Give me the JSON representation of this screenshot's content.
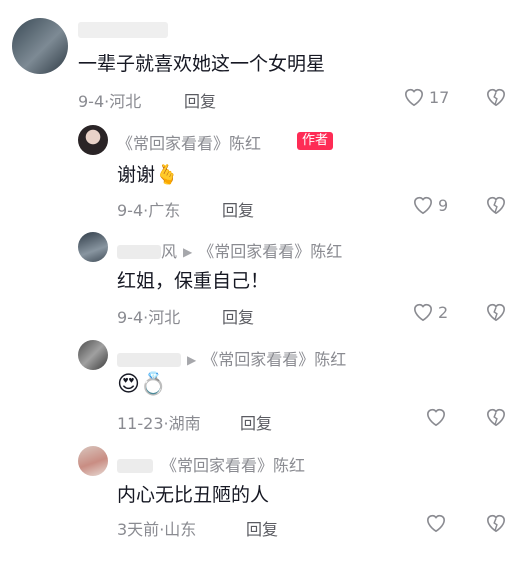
{
  "comments": [
    {
      "text": "一辈子就喜欢她这一个女明星",
      "date": "9-4",
      "location": "河北",
      "reply": "回复",
      "likes": "17"
    },
    {
      "name": "《常回家看看》陈红",
      "author_badge": "作者",
      "text": "谢谢",
      "emoji": "🫰",
      "date": "9-4",
      "location": "广东",
      "reply": "回复",
      "likes": "9"
    },
    {
      "name_visible": "风",
      "reply_to": "《常回家看看》陈红",
      "text": "红姐，保重自己！",
      "date": "9-4",
      "location": "河北",
      "reply": "回复",
      "likes": "2"
    },
    {
      "reply_to": "《常回家看看》陈红",
      "emoji": "😍💍",
      "date": "11-23",
      "location": "湖南",
      "reply": "回复",
      "likes": ""
    },
    {
      "reply_to": "《常回家看看》陈红",
      "text": "内心无比丑陋的人",
      "date": "3天前",
      "location": "山东",
      "reply": "回复",
      "likes": ""
    }
  ],
  "separator": "·"
}
